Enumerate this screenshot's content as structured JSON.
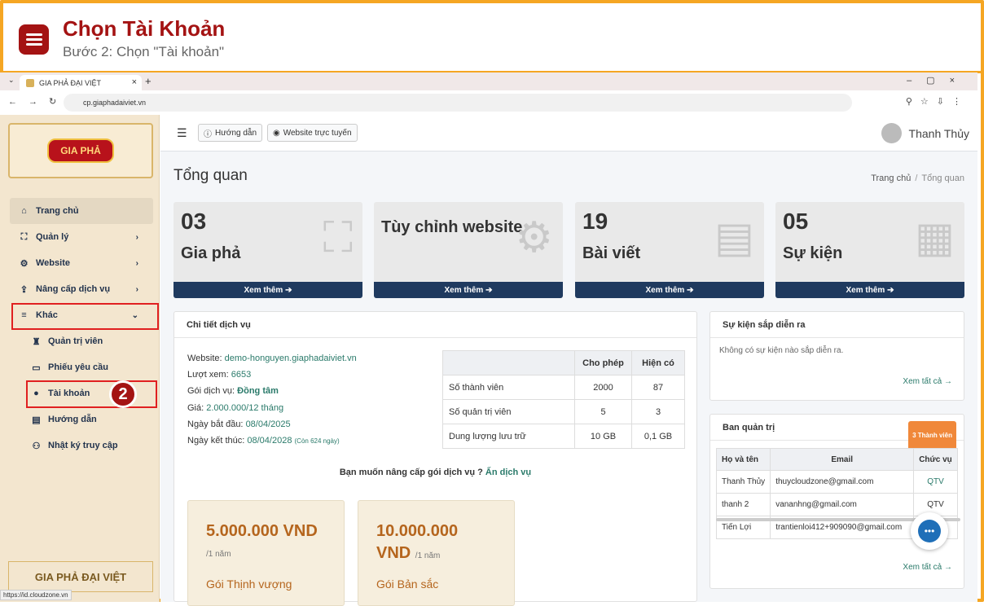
{
  "banner": {
    "title": "Chọn Tài Khoản",
    "subtitle": "Bước 2: Chọn \"Tài khoản\"",
    "step_badge": "2"
  },
  "browser": {
    "tab_title": "GIA PHẢ ĐẠI VIỆT",
    "url": "cp.giaphadaiviet.vn",
    "status_url": "https://id.cloudzone.vn"
  },
  "sidebar": {
    "logo_text": "GIA PHẢ",
    "bottom_logo": "GIA PHẢ ĐẠI VIỆT",
    "items": [
      {
        "label": "Trang chủ",
        "icon": "home-icon"
      },
      {
        "label": "Quản lý",
        "icon": "sitemap-icon"
      },
      {
        "label": "Website",
        "icon": "gear-icon"
      },
      {
        "label": "Nâng cấp dịch vụ",
        "icon": "upgrade-icon"
      },
      {
        "label": "Khác",
        "icon": "bars-icon"
      },
      {
        "label": "Quản trị viên",
        "icon": "admin-icon"
      },
      {
        "label": "Phiếu yêu cầu",
        "icon": "ticket-icon"
      },
      {
        "label": "Tài khoản",
        "icon": "user-icon"
      },
      {
        "label": "Hướng dẫn",
        "icon": "file-icon"
      },
      {
        "label": "Nhật ký truy cập",
        "icon": "users-icon"
      }
    ]
  },
  "topnav": {
    "guide_label": "Hướng dẫn",
    "website_label": "Website trực tuyến",
    "user_name": "Thanh Thủy"
  },
  "page": {
    "title": "Tổng quan",
    "breadcrumb_home": "Trang chủ",
    "breadcrumb_sep": "/",
    "breadcrumb_current": "Tổng quan"
  },
  "boxes": [
    {
      "num": "03",
      "label": "Gia phả",
      "foot": "Xem thêm"
    },
    {
      "num": "",
      "label": "Tùy chỉnh website",
      "foot": "Xem thêm"
    },
    {
      "num": "19",
      "label": "Bài viết",
      "foot": "Xem thêm"
    },
    {
      "num": "05",
      "label": "Sự kiện",
      "foot": "Xem thêm"
    }
  ],
  "service": {
    "header": "Chi tiết dịch vụ",
    "website_label": "Website:",
    "website": "demo-honguyen.giaphadaiviet.vn",
    "views_label": "Lượt xem:",
    "views": "6653",
    "plan_label": "Gói dịch vụ:",
    "plan": "Đồng tâm",
    "price_label": "Giá:",
    "price": "2.000.000/12 tháng",
    "start_label": "Ngày bắt đầu:",
    "start": "08/04/2025",
    "end_label": "Ngày kết thúc:",
    "end": "08/04/2028",
    "remaining": "(Còn 624 ngày)",
    "table_headers": [
      "",
      "Cho phép",
      "Hiện có"
    ],
    "table_rows": [
      [
        "Số thành viên",
        "2000",
        "87"
      ],
      [
        "Số quản trị viên",
        "5",
        "3"
      ],
      [
        "Dung lượng lưu trữ",
        "10 GB",
        "0,1 GB"
      ]
    ],
    "upgrade_text": "Bạn muốn nâng cấp gói dịch vụ ?",
    "upgrade_link": "Ấn dịch vụ",
    "packages": [
      {
        "price": "5.000.000 VND",
        "period": "/1 năm",
        "name": "Gói Thịnh vượng"
      },
      {
        "price": "10.000.000",
        "price2": "VND",
        "period": "/1 năm",
        "name": "Gói Bản sắc"
      }
    ]
  },
  "events": {
    "header": "Sự kiện sắp diễn ra",
    "empty": "Không có sự kiện nào sắp diễn ra.",
    "see_all": "Xem tất cả"
  },
  "admins": {
    "header": "Ban quản trị",
    "badge": "3 Thành viên",
    "columns": [
      "Họ và tên",
      "Email",
      "Chức vụ"
    ],
    "rows": [
      [
        "Thanh Thủy",
        "thuycloudzone@gmail.com",
        "QTV"
      ],
      [
        "thanh 2",
        "vananhng@gmail.com",
        "QTV"
      ],
      [
        "Tiến Lợi",
        "trantienloi412+909090@gmail.com",
        ""
      ]
    ],
    "see_all": "Xem tất cả"
  }
}
